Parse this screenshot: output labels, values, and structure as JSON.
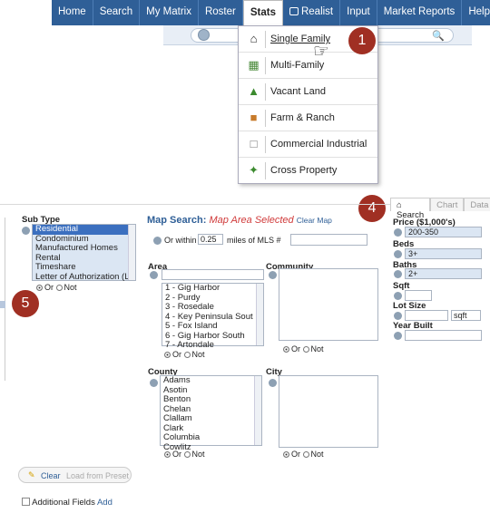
{
  "nav": {
    "items": [
      "Home",
      "Search",
      "My Matrix",
      "Roster",
      "Stats",
      "Realist",
      "Input",
      "Market Reports",
      "Help"
    ],
    "active": "Stats"
  },
  "dropdown": {
    "items": [
      {
        "label": "Single Family",
        "icon": "house-icon"
      },
      {
        "label": "Multi-Family",
        "icon": "building-icon"
      },
      {
        "label": "Vacant Land",
        "icon": "tree-icon"
      },
      {
        "label": "Farm & Ranch",
        "icon": "barn-icon"
      },
      {
        "label": "Commercial Industrial",
        "icon": "commercial-icon"
      },
      {
        "label": "Cross Property",
        "icon": "cross-property-icon"
      }
    ]
  },
  "badges": [
    "1",
    "4",
    "5"
  ],
  "tabs": [
    "Search",
    "Chart",
    "Data"
  ],
  "subtype": {
    "label": "Sub Type",
    "items": [
      "Residential",
      "Condominium",
      "Manufactured Homes",
      "Rental",
      "Timeshare",
      "Letter of Authorization (LC"
    ],
    "or": "Or",
    "not": "Not"
  },
  "map": {
    "title": "Map Search:",
    "status": "Map Area Selected",
    "clear": "Clear Map",
    "within_prefix": "Or within",
    "within_value": "0.25",
    "within_suffix": "miles of MLS #"
  },
  "area": {
    "label": "Area",
    "items": [
      "1 - Gig Harbor",
      "2 - Purdy",
      "3 - Rosedale",
      "4 - Key Peninsula Sout",
      "5 - Fox Island",
      "6 - Gig Harbor South",
      "7 - Artondale"
    ],
    "or": "Or",
    "not": "Not"
  },
  "community": {
    "label": "Community",
    "or": "Or",
    "not": "Not"
  },
  "county": {
    "label": "County",
    "items": [
      "Adams",
      "Asotin",
      "Benton",
      "Chelan",
      "Clallam",
      "Clark",
      "Columbia",
      "Cowlitz"
    ],
    "or": "Or",
    "not": "Not"
  },
  "city": {
    "label": "City",
    "or": "Or",
    "not": "Not"
  },
  "right": {
    "price_label": "Price ($1,000's)",
    "price_value": "200-350",
    "beds_label": "Beds",
    "beds_value": "3+",
    "baths_label": "Baths",
    "baths_value": "2+",
    "sqft_label": "Sqft",
    "lot_label": "Lot Size",
    "lot_unit": "sqft",
    "year_label": "Year Built"
  },
  "buttons": {
    "clear": "Clear",
    "load_preset": "Load from Preset"
  },
  "footer": {
    "label": "Additional Fields",
    "add": "Add"
  }
}
